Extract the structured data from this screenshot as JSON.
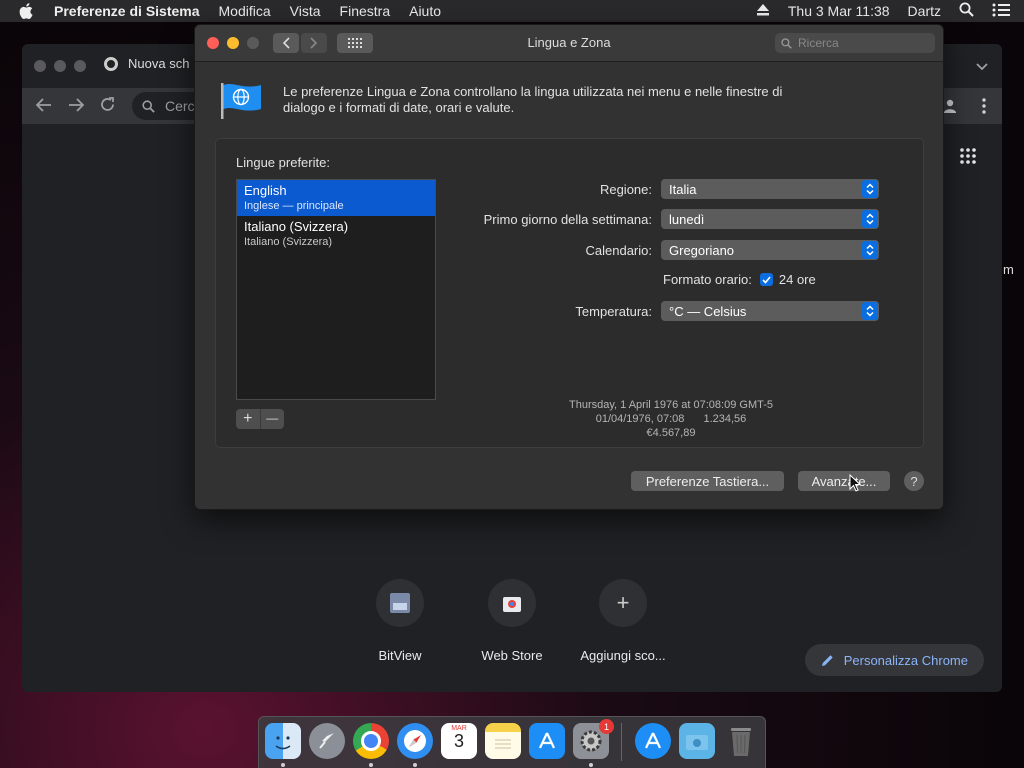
{
  "menubar": {
    "app_name": "Preferenze di Sistema",
    "items": [
      "Modifica",
      "Vista",
      "Finestra",
      "Aiuto"
    ],
    "datetime": "Thu 3 Mar  11:38",
    "user": "Dartz"
  },
  "chrome": {
    "tab_title": "Nuova sch",
    "omnibox_text": "Cerc",
    "shortcuts": [
      {
        "label": "BitView"
      },
      {
        "label": "Web Store"
      },
      {
        "label": "Aggiungi sco..."
      }
    ],
    "customize_label": "Personalizza Chrome",
    "edge_text": "m"
  },
  "window": {
    "title": "Lingua e Zona",
    "search_placeholder": "Ricerca",
    "intro": "Le preferenze Lingua e Zona controllano la lingua utilizzata nei menu e nelle finestre di dialogo e i formati di date, orari e valute.",
    "languages_label": "Lingue preferite:",
    "languages": [
      {
        "name": "English",
        "sub": "Inglese — principale",
        "selected": true
      },
      {
        "name": "Italiano (Svizzera)",
        "sub": "Italiano (Svizzera)",
        "selected": false
      }
    ],
    "add_symbol": "+",
    "remove_symbol": "—",
    "settings": {
      "region_label": "Regione:",
      "region_value": "Italia",
      "first_day_label": "Primo giorno della settimana:",
      "first_day_value": "lunedì",
      "calendar_label": "Calendario:",
      "calendar_value": "Gregoriano",
      "time_format_label": "Formato orario:",
      "time_format_value": "24 ore",
      "time_format_checked": true,
      "temperature_label": "Temperatura:",
      "temperature_value": "°C — Celsius"
    },
    "sample": {
      "line1": "Thursday, 1 April 1976 at 07:08:09 GMT-5",
      "date_time": "01/04/1976, 07:08",
      "number": "1.234,56",
      "currency": "€4.567,89"
    },
    "keyboard_button": "Preferenze Tastiera...",
    "advanced_button": "Avanzate...",
    "help_symbol": "?"
  },
  "dock": {
    "calendar_month": "MAR",
    "calendar_day": "3",
    "prefs_badge": "1"
  },
  "colors": {
    "accent": "#0b6ee0",
    "selection": "#0b5acf",
    "chrome_link": "#8ab4f8"
  }
}
